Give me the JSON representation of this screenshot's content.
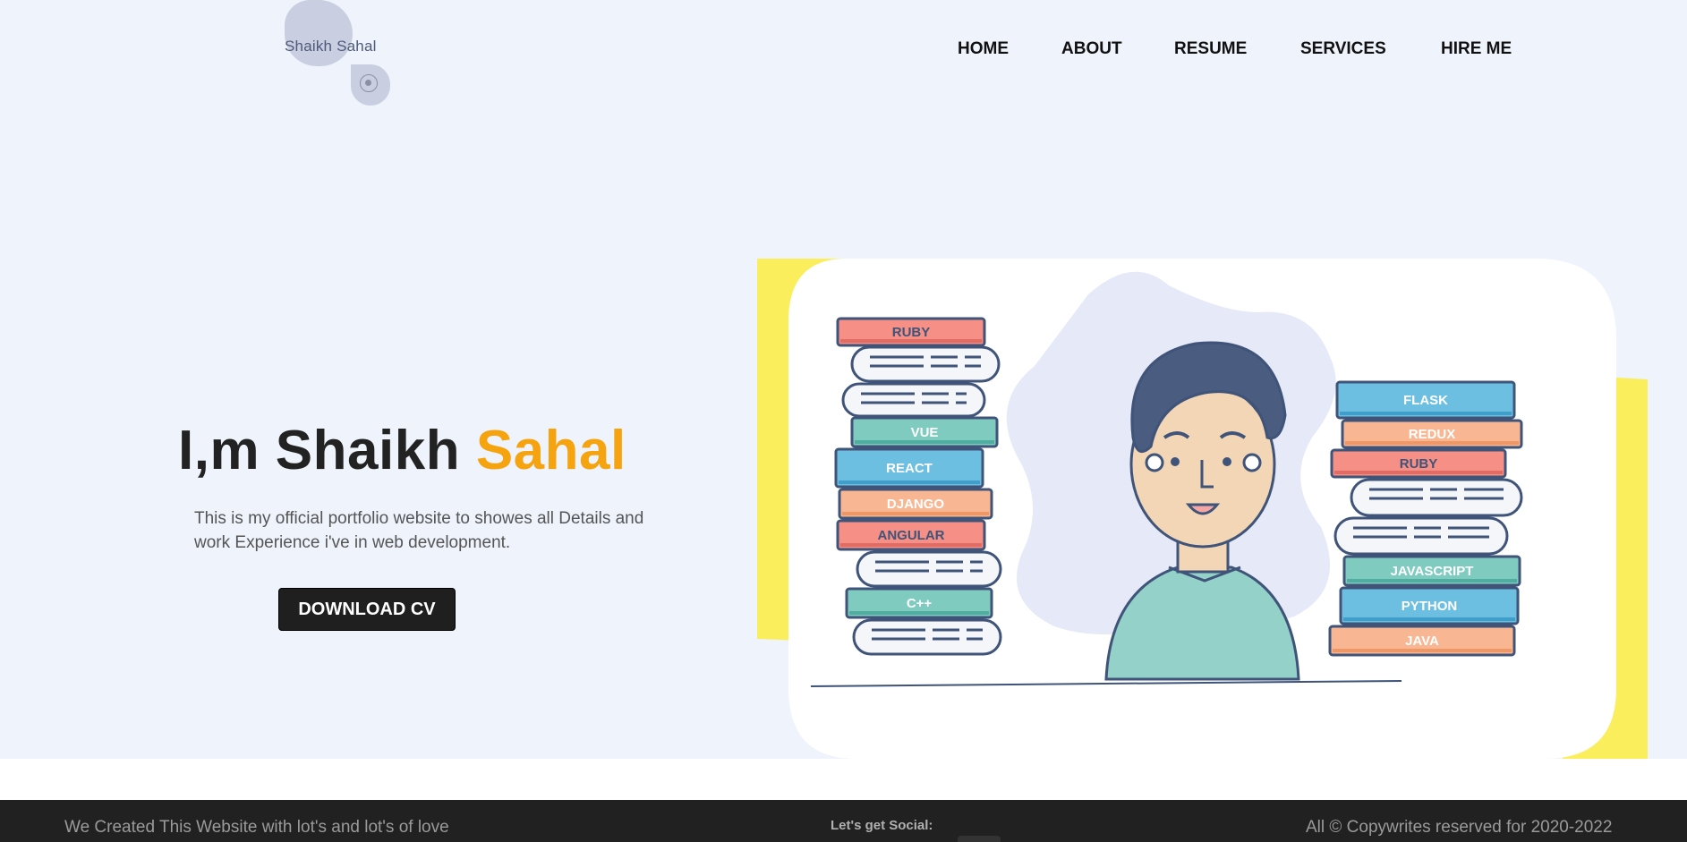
{
  "brand": {
    "logo_text": "Shaikh Sahal"
  },
  "nav": {
    "home": "HOME",
    "about": "ABOUT",
    "resume": "RESUME",
    "services": "SERVICES",
    "hire": "HIRE ME"
  },
  "hero": {
    "headline_prefix": "I,m Shaikh ",
    "headline_accent": "Sahal",
    "description": "This is my official portfolio website to showes all Details and work Experience i've in web development.",
    "cta_label": "DOWNLOAD CV"
  },
  "illustration": {
    "left_stack": [
      "RUBY",
      "VUE",
      "REACT",
      "DJANGO",
      "ANGULAR",
      "C++"
    ],
    "right_stack": [
      "FLASK",
      "REDUX",
      "RUBY",
      "JAVASCRIPT",
      "PYTHON",
      "JAVA"
    ]
  },
  "footer": {
    "left_text": "We Created This Website with lot's and lot's of love",
    "social_label": "Let's get Social:",
    "copyright": "All © Copywrites reserved for 2020-2022"
  },
  "colors": {
    "accent": "#f5a30f",
    "hero_bg": "#eef3fc",
    "footer_bg": "#212121",
    "button_bg": "#1f1f1f"
  }
}
